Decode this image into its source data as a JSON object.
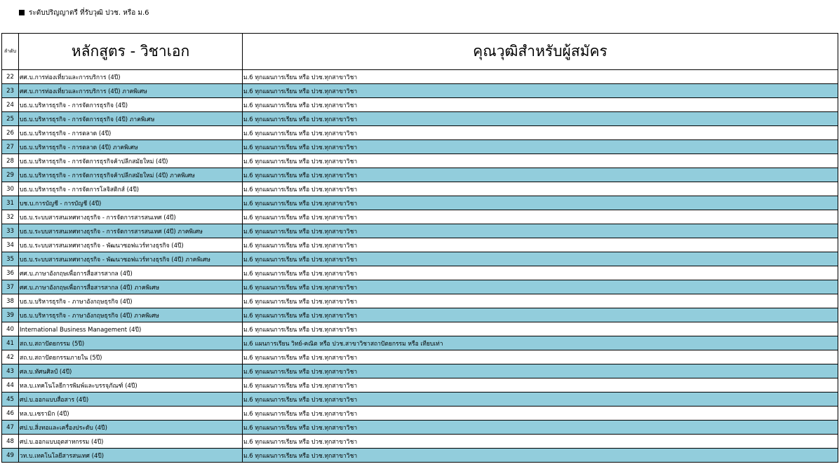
{
  "heading": "ระดับปริญญาตรี ที่รับวุฒิ ปวช. หรือ ม.6",
  "table": {
    "headers": {
      "no": "ลำดับ",
      "course": "หลักสูตร - วิชาเอก",
      "qualification": "คุณวุฒิสำหรับผู้สมัคร"
    },
    "colors": {
      "alt_row_fill": "#92cddc",
      "row_fill": "#ffffff"
    },
    "rows": [
      {
        "no": "22",
        "course": "ศศ.บ.การท่องเที่ยวและการบริการ (4ปี)",
        "qualification": "ม.6 ทุกแผนการเรียน หรือ ปวช.ทุกสาขาวิชา",
        "highlight": false
      },
      {
        "no": "23",
        "course": "ศศ.บ.การท่องเที่ยวและการบริการ (4ปี) ภาคพิเศษ",
        "qualification": "ม.6 ทุกแผนการเรียน หรือ ปวช.ทุกสาขาวิชา",
        "highlight": true
      },
      {
        "no": "24",
        "course": "บธ.บ.บริหารธุรกิจ - การจัดการธุรกิจ (4ปี)",
        "qualification": "ม.6 ทุกแผนการเรียน หรือ ปวช.ทุกสาขาวิชา",
        "highlight": false
      },
      {
        "no": "25",
        "course": "บธ.บ.บริหารธุรกิจ - การจัดการธุรกิจ (4ปี) ภาคพิเศษ",
        "qualification": "ม.6 ทุกแผนการเรียน หรือ ปวช.ทุกสาขาวิชา",
        "highlight": true
      },
      {
        "no": "26",
        "course": "บธ.บ.บริหารธุรกิจ - การตลาด (4ปี)",
        "qualification": "ม.6 ทุกแผนการเรียน หรือ ปวช.ทุกสาขาวิชา",
        "highlight": false
      },
      {
        "no": "27",
        "course": "บธ.บ.บริหารธุรกิจ - การตลาด (4ปี) ภาคพิเศษ",
        "qualification": "ม.6 ทุกแผนการเรียน หรือ ปวช.ทุกสาขาวิชา",
        "highlight": true
      },
      {
        "no": "28",
        "course": "บธ.บ.บริหารธุรกิจ - การจัดการธุรกิจค้าปลีกสมัยใหม่ (4ปี)",
        "qualification": "ม.6 ทุกแผนการเรียน หรือ ปวช.ทุกสาขาวิชา",
        "highlight": false
      },
      {
        "no": "29",
        "course": "บธ.บ.บริหารธุรกิจ - การจัดการธุรกิจค้าปลีกสมัยใหม่ (4ปี) ภาคพิเศษ",
        "qualification": "ม.6 ทุกแผนการเรียน หรือ ปวช.ทุกสาขาวิชา",
        "highlight": true
      },
      {
        "no": "30",
        "course": "บธ.บ.บริหารธุรกิจ - การจัดการโลจิสติกส์ (4ปี)",
        "qualification": "ม.6 ทุกแผนการเรียน หรือ ปวช.ทุกสาขาวิชา",
        "highlight": false
      },
      {
        "no": "31",
        "course": "บช.บ.การบัญชี - การบัญชี (4ปี)",
        "qualification": "ม.6 ทุกแผนการเรียน หรือ ปวช.ทุกสาขาวิชา",
        "highlight": true
      },
      {
        "no": "32",
        "course": "บธ.บ.ระบบสารสนเทศทางธุรกิจ - การจัดการสารสนเทศ (4ปี)",
        "qualification": "ม.6 ทุกแผนการเรียน หรือ ปวช.ทุกสาขาวิชา",
        "highlight": false
      },
      {
        "no": "33",
        "course": "บธ.บ.ระบบสารสนเทศทางธุรกิจ - การจัดการสารสนเทศ (4ปี) ภาคพิเศษ",
        "qualification": "ม.6 ทุกแผนการเรียน หรือ ปวช.ทุกสาขาวิชา",
        "highlight": true
      },
      {
        "no": "34",
        "course": "บธ.บ.ระบบสารสนเทศทางธุรกิจ - พัฒนาซอฟแวร์ทางธุรกิจ (4ปี)",
        "qualification": "ม.6 ทุกแผนการเรียน หรือ ปวช.ทุกสาขาวิชา",
        "highlight": false
      },
      {
        "no": "35",
        "course": "บธ.บ.ระบบสารสนเทศทางธุรกิจ - พัฒนาซอฟแวร์ทางธุรกิจ (4ปี) ภาคพิเศษ",
        "qualification": "ม.6 ทุกแผนการเรียน หรือ ปวช.ทุกสาขาวิชา",
        "highlight": true
      },
      {
        "no": "36",
        "course": "ศศ.บ.ภาษาอังกฤษเพื่อการสื่อสารสากล (4ปี)",
        "qualification": "ม.6 ทุกแผนการเรียน หรือ ปวช.ทุกสาขาวิชา",
        "highlight": false
      },
      {
        "no": "37",
        "course": "ศศ.บ.ภาษาอังกฤษเพื่อการสื่อสารสากล (4ปี) ภาคพิเศษ",
        "qualification": "ม.6 ทุกแผนการเรียน หรือ ปวช.ทุกสาขาวิชา",
        "highlight": true
      },
      {
        "no": "38",
        "course": "บธ.บ.บริหารธุรกิจ - ภาษาอังกฤษธุรกิจ (4ปี)",
        "qualification": "ม.6 ทุกแผนการเรียน หรือ ปวช.ทุกสาขาวิชา",
        "highlight": false
      },
      {
        "no": "39",
        "course": "บธ.บ.บริหารธุรกิจ - ภาษาอังกฤษธุรกิจ (4ปี) ภาคพิเศษ",
        "qualification": "ม.6 ทุกแผนการเรียน หรือ ปวช.ทุกสาขาวิชา",
        "highlight": true
      },
      {
        "no": "40",
        "course": "International Business Management (4ปี)",
        "qualification": "ม.6 ทุกแผนการเรียน หรือ ปวช.ทุกสาขาวิชา",
        "highlight": false
      },
      {
        "no": "41",
        "course": "สถ.บ.สถาปัตยกรรม (5ปี)",
        "qualification": "ม.6 แผนการเรียน วิทย์-คณิต หรือ ปวช.สาขาวิชาสถาปัตยกรรม หรือ เทียบเท่า",
        "highlight": true
      },
      {
        "no": "42",
        "course": "สถ.บ.สถาปัตยกรรมภายใน (5ปี)",
        "qualification": "ม.6 ทุกแผนการเรียน หรือ ปวช.ทุกสาขาวิชา",
        "highlight": false
      },
      {
        "no": "43",
        "course": "ศล.บ.ทัศนศิลป์ (4ปี)",
        "qualification": "ม.6 ทุกแผนการเรียน หรือ ปวช.ทุกสาขาวิชา",
        "highlight": true
      },
      {
        "no": "44",
        "course": "ทล.บ.เทคโนโลยีการพิมพ์และบรรจุภัณฑ์ (4ปี)",
        "qualification": "ม.6 ทุกแผนการเรียน หรือ ปวช.ทุกสาขาวิชา",
        "highlight": false
      },
      {
        "no": "45",
        "course": "ศป.บ.ออกแบบสื่อสาร (4ปี)",
        "qualification": "ม.6 ทุกแผนการเรียน หรือ ปวช.ทุกสาขาวิชา",
        "highlight": true
      },
      {
        "no": "46",
        "course": "ทล.บ.เซรามิก  (4ปี)",
        "qualification": "ม.6 ทุกแผนการเรียน หรือ ปวช.ทุกสาขาวิชา",
        "highlight": false
      },
      {
        "no": "47",
        "course": "ศป.บ.สิ่งทอและเครื่องประดับ (4ปี)",
        "qualification": "ม.6 ทุกแผนการเรียน หรือ ปวช.ทุกสาขาวิชา",
        "highlight": true
      },
      {
        "no": "48",
        "course": "ศป.บ.ออกแบบอุตสาหกรรม (4ปี)",
        "qualification": "ม.6 ทุกแผนการเรียน หรือ ปวช.ทุกสาขาวิชา",
        "highlight": false
      },
      {
        "no": "49",
        "course": "วท.บ.เทคโนโลยีสารสนเทศ (4ปี)",
        "qualification": "ม.6 ทุกแผนการเรียน หรือ ปวช.ทุกสาขาวิชา",
        "highlight": true
      }
    ]
  }
}
